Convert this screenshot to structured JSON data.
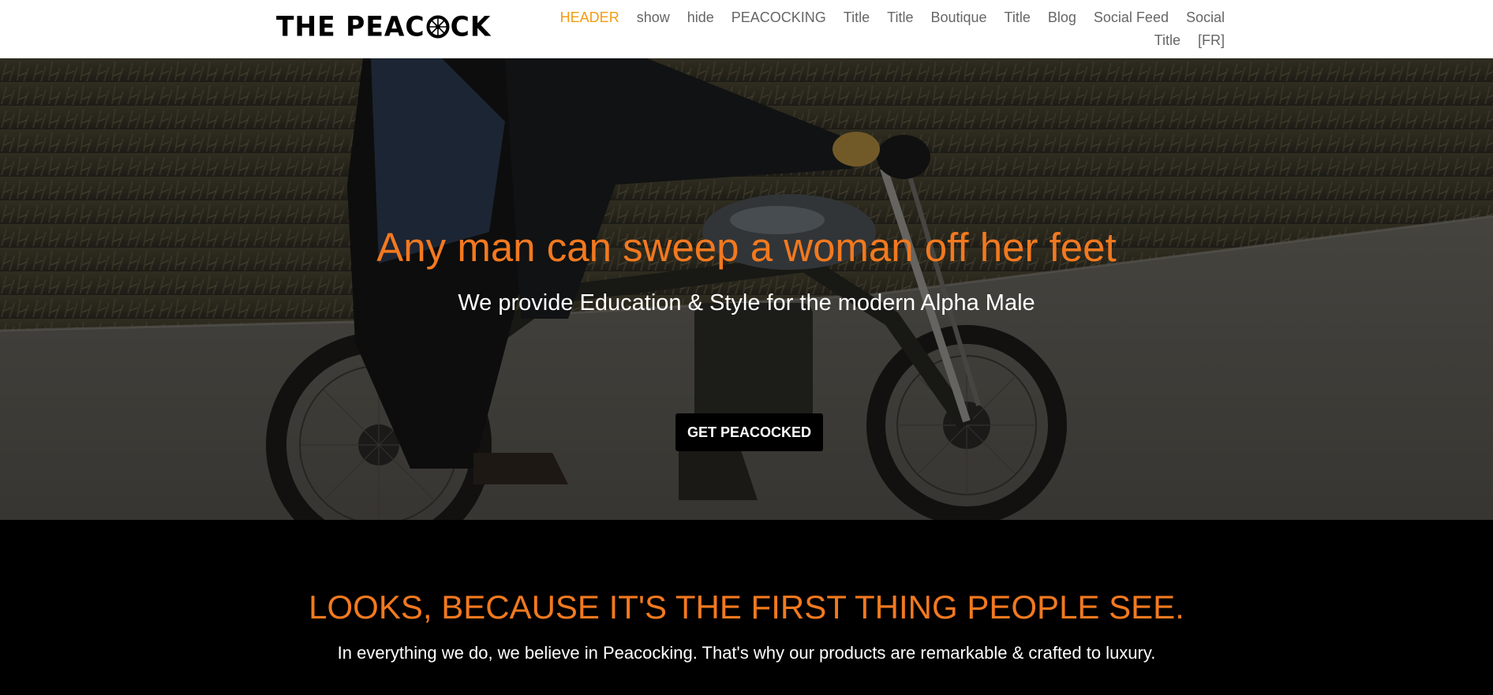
{
  "header": {
    "logo": {
      "text_before": "THE PEAC",
      "text_after": "CK",
      "wheel_icon": "spoked-wheel-icon"
    },
    "nav": {
      "row1": [
        "HEADER",
        "show",
        "hide",
        "PEACOCKING",
        "Title",
        "Title",
        "Boutique",
        "Title",
        "Blog",
        "Social Feed",
        "Social"
      ],
      "row2": [
        "Title",
        "[FR]"
      ],
      "active_index": 0
    }
  },
  "hero": {
    "title": "Any man can sweep a woman off her feet",
    "subtitle": "We provide Education & Style for the modern Alpha Male",
    "cta_label": "GET PEACOCKED"
  },
  "intro": {
    "title": "LOOKS, BECAUSE IT'S THE FIRST THING PEOPLE SEE.",
    "text": "In everything we do, we believe in Peacocking. That's why our products are remarkable & crafted to luxury."
  },
  "colors": {
    "accent_orange": "#f2791f",
    "nav_active": "#f39c12",
    "nav_text": "#666666",
    "header_bg": "#ffffff",
    "section_bg": "#000000"
  }
}
